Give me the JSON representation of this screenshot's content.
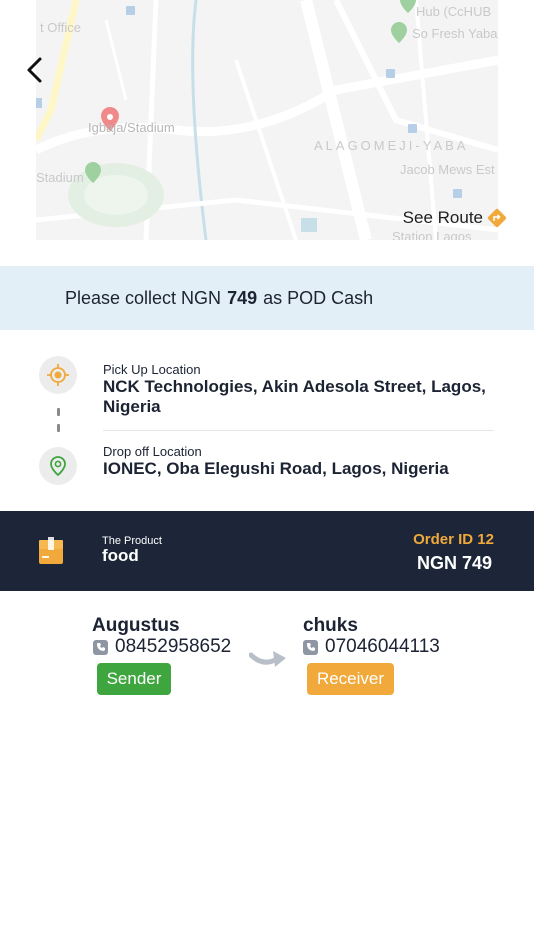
{
  "map": {
    "labels": {
      "hub": "Hub (CcHUB",
      "office": "t Office",
      "so_fresh": "So Fresh Yaba",
      "igbaja": "Igbaja/Stadium",
      "alagomeji": "ALAGOMEJI-YABA",
      "jacob": "Jacob Mews Est",
      "stadium": "Stadium",
      "station": "Station Lagos"
    },
    "see_route_label": "See Route",
    "back_icon": "chevron-left-icon",
    "route_icon": "directions-icon"
  },
  "pod": {
    "prefix": "Please collect NGN",
    "amount": "749",
    "suffix": "as POD Cash"
  },
  "pickup": {
    "caption": "Pick Up Location",
    "address": "NCK Technologies, Akin Adesola Street, Lagos, Nigeria",
    "icon": "crosshair-icon"
  },
  "dropoff": {
    "caption": "Drop off Location",
    "address": "IONEC, Oba Elegushi Road, Lagos, Nigeria",
    "icon": "map-pin-icon"
  },
  "order": {
    "product_caption": "The Product",
    "product_name": "food",
    "order_id": "Order ID 12",
    "price": "NGN 749",
    "icon": "package-icon"
  },
  "sender": {
    "name": "Augustus",
    "phone": "08452958652",
    "role_label": "Sender"
  },
  "receiver": {
    "name": "chuks",
    "phone": "07046044113",
    "role_label": "Receiver"
  },
  "colors": {
    "navy": "#1c2638",
    "accent_orange": "#f0a93a",
    "sender_green": "#3fa53f",
    "banner_blue": "#e3eff7"
  }
}
